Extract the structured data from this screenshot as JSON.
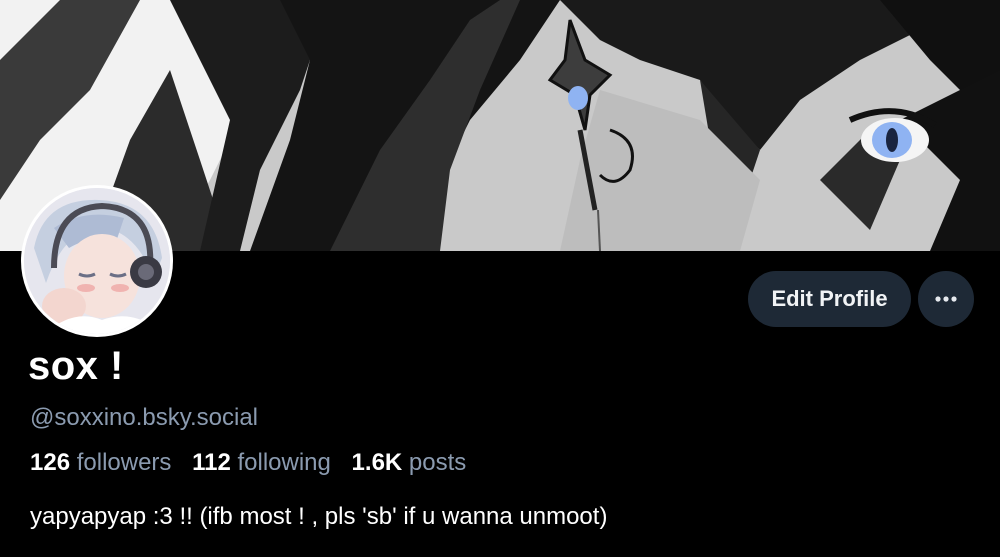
{
  "profile": {
    "display_name": "sox !",
    "handle": "@soxxino.bsky.social",
    "bio": "yapyapyap :3 !! (ifb most ! , pls 'sb' if u wanna unmoot)"
  },
  "stats": {
    "followers_count": "126",
    "followers_label": "followers",
    "following_count": "112",
    "following_label": "following",
    "posts_count": "1.6K",
    "posts_label": "posts"
  },
  "actions": {
    "edit_profile_label": "Edit Profile",
    "more_icon": "ellipsis-icon"
  },
  "colors": {
    "background": "#000000",
    "button_bg": "#1e2936",
    "muted_text": "#8b9bb0",
    "eye_accent": "#8fb3f2"
  }
}
